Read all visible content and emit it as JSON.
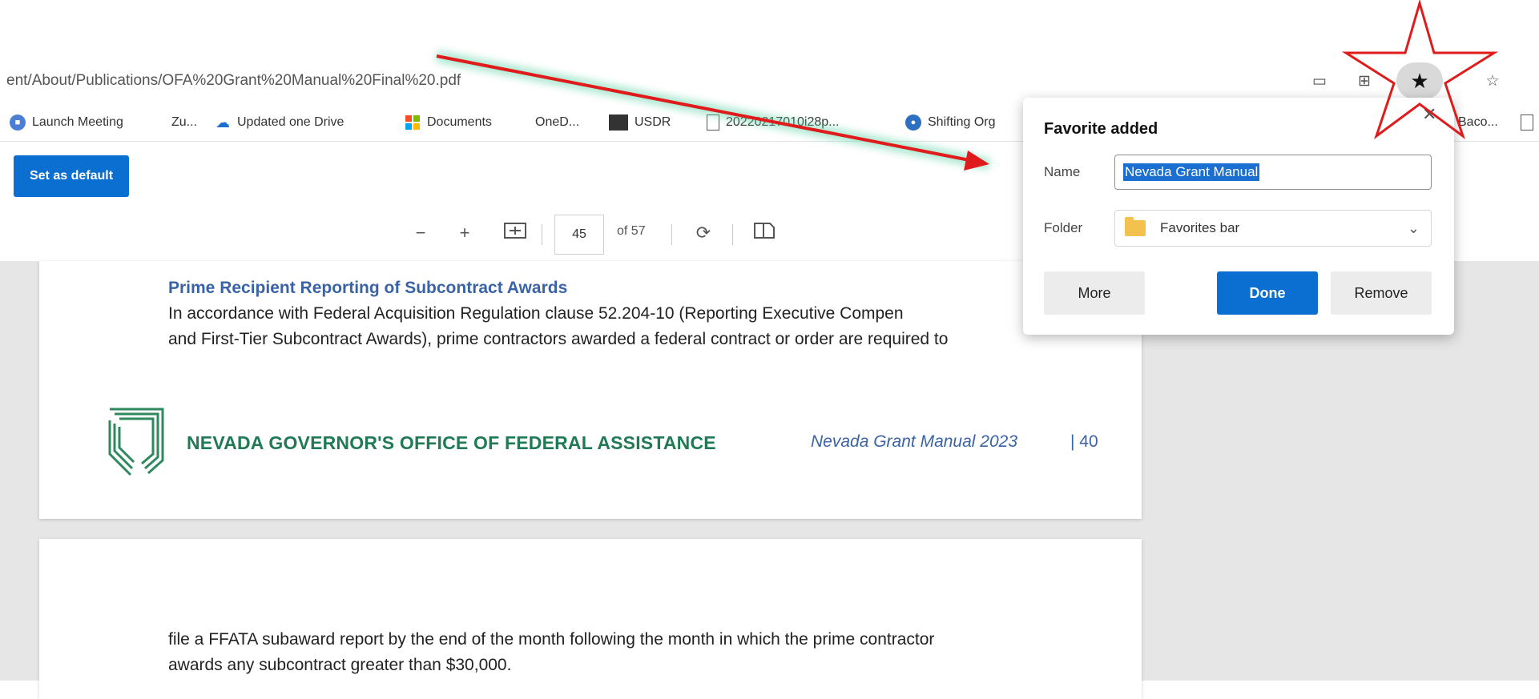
{
  "address_bar": {
    "url": "ent/About/Publications/OFA%20Grant%20Manual%20Final%20.pdf"
  },
  "favorites_bar": {
    "items": [
      {
        "label": "Launch Meeting",
        "icon": "video-icon"
      },
      {
        "label": "Zu..."
      },
      {
        "label": "Updated one Drive",
        "icon": "cloud-icon"
      },
      {
        "label": "Documents",
        "icon": "office-icon"
      },
      {
        "label": "OneD..."
      },
      {
        "label": "USDR",
        "icon": "image-icon"
      },
      {
        "label": "20220217010i28p...",
        "icon": "page-icon"
      },
      {
        "label": "Shifting Org",
        "icon": "globe-icon"
      },
      {
        "label": "Baco..."
      }
    ]
  },
  "pdf_bar": {
    "set_default_label": "Set as default",
    "page_current": "45",
    "page_total": "of 57",
    "zoom_out": "−",
    "zoom_in": "+"
  },
  "document": {
    "section_heading": "Prime Recipient Reporting of Subcontract Awards",
    "para1_line1": "In accordance with Federal Acquisition Regulation clause 52.204-10 (Reporting Executive Compen",
    "para1_line2": "and First-Tier Subcontract Awards), prime contractors awarded a federal contract or order are required to",
    "footer_org": "NEVADA GOVERNOR'S OFFICE OF FEDERAL ASSISTANCE",
    "footer_manual": "Nevada Grant Manual 2023",
    "footer_page": "| 40",
    "para2_line1": "file a FFATA subaward report by the end of the month following the month in which the prime contractor",
    "para2_line2": "awards any subcontract greater than $30,000."
  },
  "favorite_popup": {
    "title": "Favorite added",
    "name_label": "Name",
    "name_value": "Nevada Grant Manual",
    "folder_label": "Folder",
    "folder_value": "Favorites bar",
    "more_label": "More",
    "done_label": "Done",
    "remove_label": "Remove"
  },
  "colors": {
    "accent": "#0a6fd1",
    "annotation": "#e01b1b",
    "heading_blue": "#3a63a6",
    "org_green": "#1f7a55"
  }
}
